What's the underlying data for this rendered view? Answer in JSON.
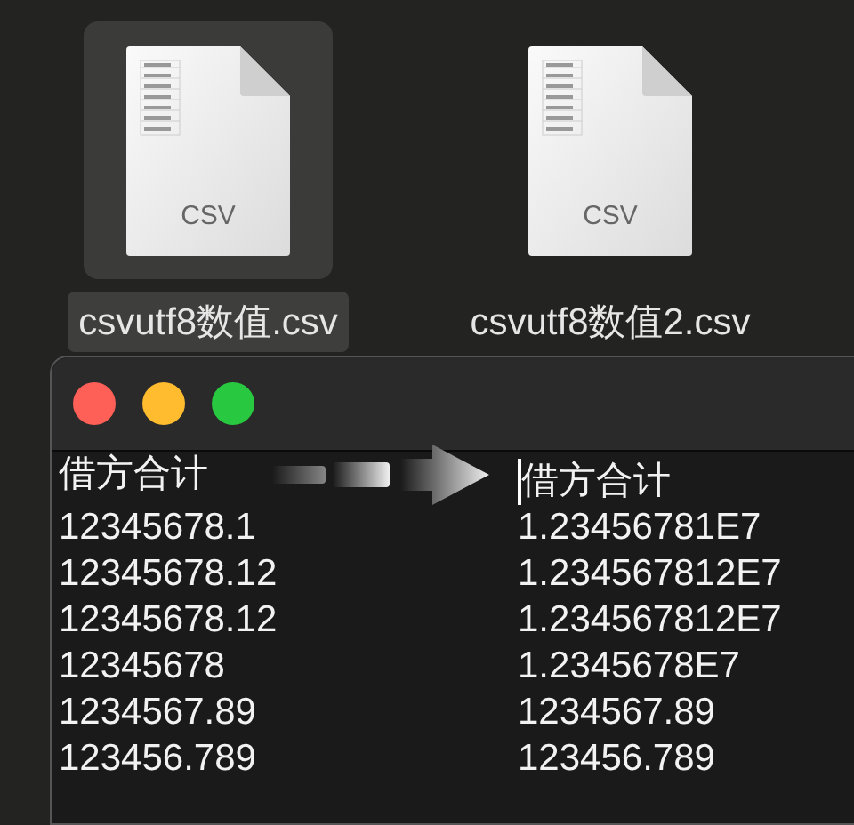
{
  "files": [
    {
      "name": "csvutf8数值.csv",
      "type_label": "CSV",
      "selected": true
    },
    {
      "name": "csvutf8数值2.csv",
      "type_label": "CSV",
      "selected": false
    }
  ],
  "window": {
    "left_lines": [
      "借方合计",
      "12345678.1",
      "12345678.12",
      "12345678.12",
      "12345678",
      "1234567.89",
      "123456.789"
    ],
    "right_lines": [
      "借方合计",
      "1.23456781E7",
      "1.234567812E7",
      "1.234567812E7",
      "1.2345678E7",
      "1234567.89",
      "123456.789"
    ]
  }
}
